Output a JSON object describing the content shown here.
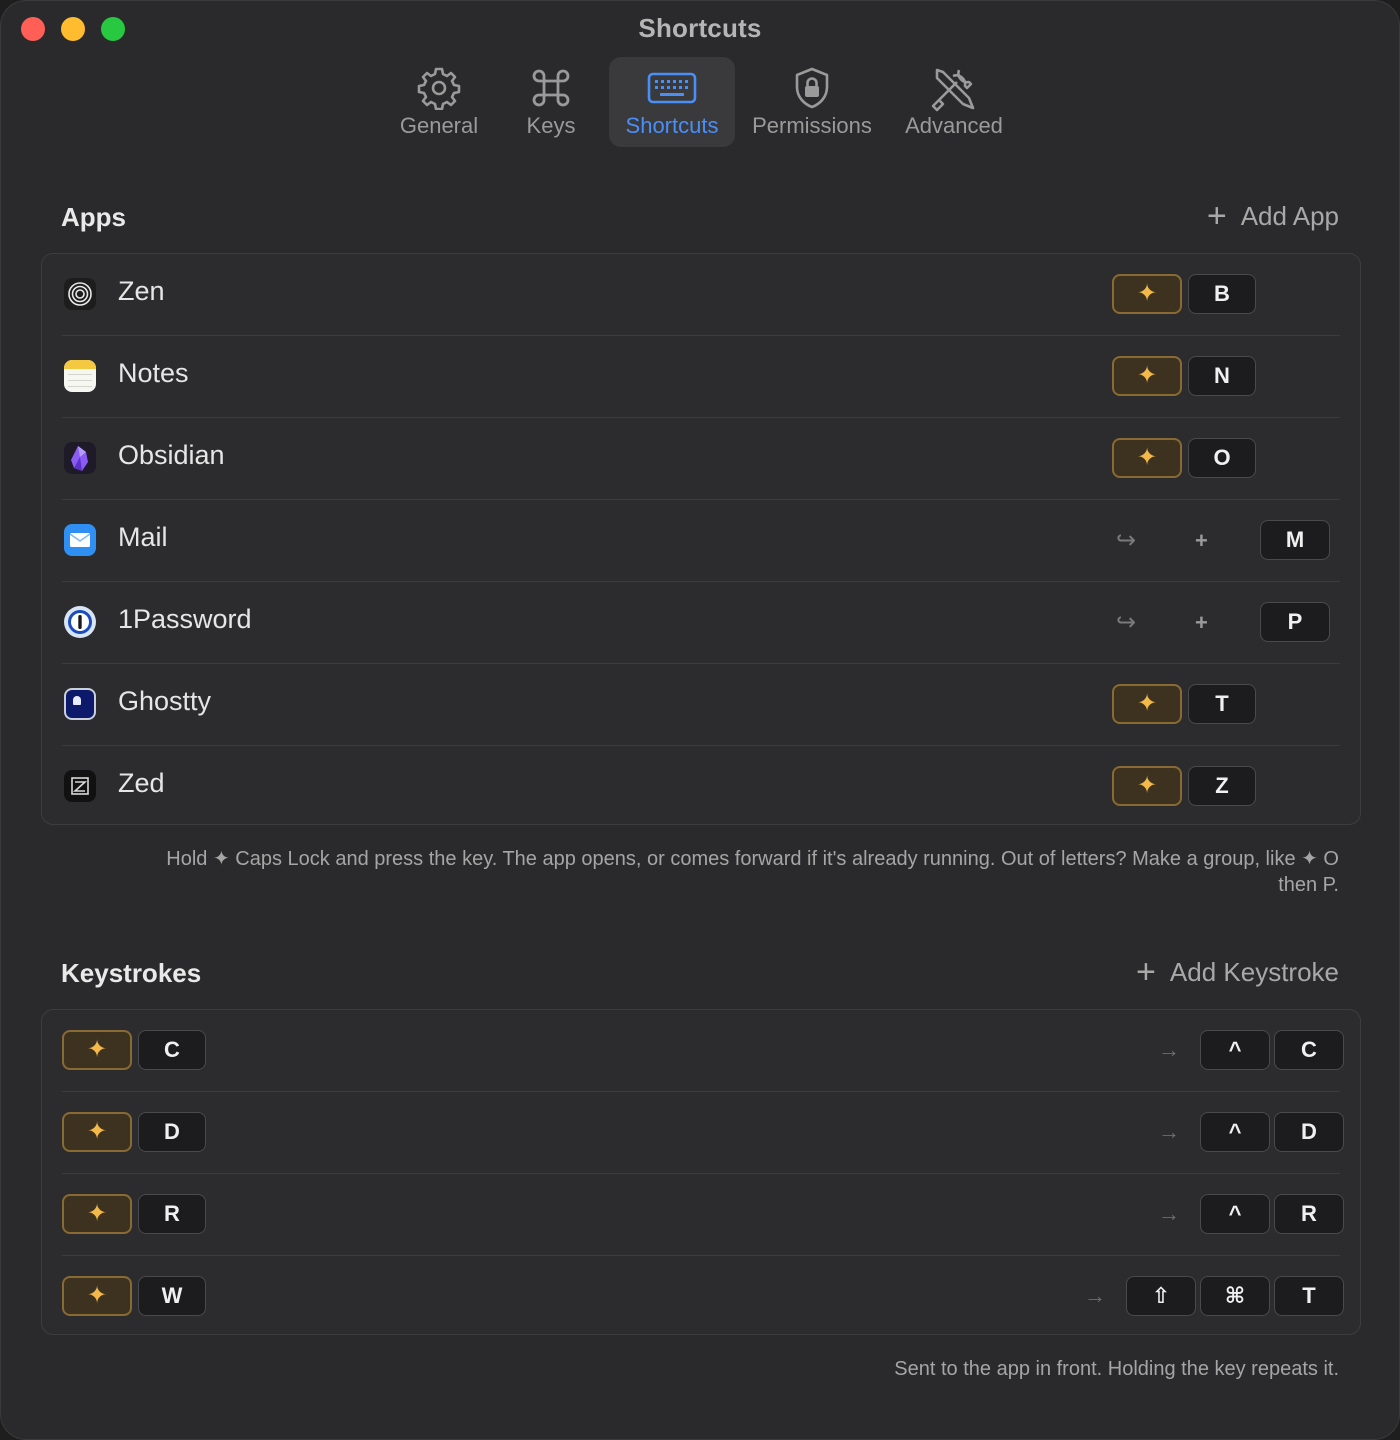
{
  "window": {
    "title": "Shortcuts"
  },
  "toolbar": {
    "tabs": [
      {
        "label": "General",
        "icon": "gear-icon"
      },
      {
        "label": "Keys",
        "icon": "command-icon"
      },
      {
        "label": "Shortcuts",
        "icon": "keyboard-icon",
        "active": true
      },
      {
        "label": "Permissions",
        "icon": "shield-lock-icon"
      },
      {
        "label": "Advanced",
        "icon": "tools-icon"
      }
    ]
  },
  "apps": {
    "title": "Apps",
    "add_label": "Add App",
    "rows": [
      {
        "name": "Zen",
        "icon": "zen-app-icon",
        "trigger": "hyper",
        "key": "B"
      },
      {
        "name": "Notes",
        "icon": "notes-app-icon",
        "trigger": "hyper",
        "key": "N"
      },
      {
        "name": "Obsidian",
        "icon": "obsidian-app-icon",
        "trigger": "hyper",
        "key": "O"
      },
      {
        "name": "Mail",
        "icon": "mail-app-icon",
        "trigger": "group",
        "plus": "+",
        "key": "M"
      },
      {
        "name": "1Password",
        "icon": "onepassword-app-icon",
        "trigger": "group",
        "plus": "+",
        "key": "P"
      },
      {
        "name": "Ghostty",
        "icon": "ghostty-app-icon",
        "trigger": "hyper",
        "key": "T"
      },
      {
        "name": "Zed",
        "icon": "zed-app-icon",
        "trigger": "hyper",
        "key": "Z"
      }
    ],
    "hint_line1": "Hold ✦ Caps Lock and press the key. The app opens, or comes forward if it's already running. Out of letters? Make a group, like ✦ O",
    "hint_line2": "then P."
  },
  "keystrokes": {
    "title": "Keystrokes",
    "add_label": "Add Keystroke",
    "rows": [
      {
        "key": "C",
        "output": [
          "^",
          "C"
        ]
      },
      {
        "key": "D",
        "output": [
          "^",
          "D"
        ]
      },
      {
        "key": "R",
        "output": [
          "^",
          "R"
        ]
      },
      {
        "key": "W",
        "output": [
          "⇧",
          "⌘",
          "T"
        ]
      }
    ],
    "hint": "Sent to the app in front. Holding the key repeats it."
  },
  "symbols": {
    "hyper": "✦",
    "hook_arrow": "↪",
    "right_arrow": "→"
  },
  "colors": {
    "accent": "#4a8ef7",
    "hyper": "#f2b84a",
    "close": "#ff5f57",
    "minimize": "#febc2e",
    "maximize": "#28c840"
  }
}
